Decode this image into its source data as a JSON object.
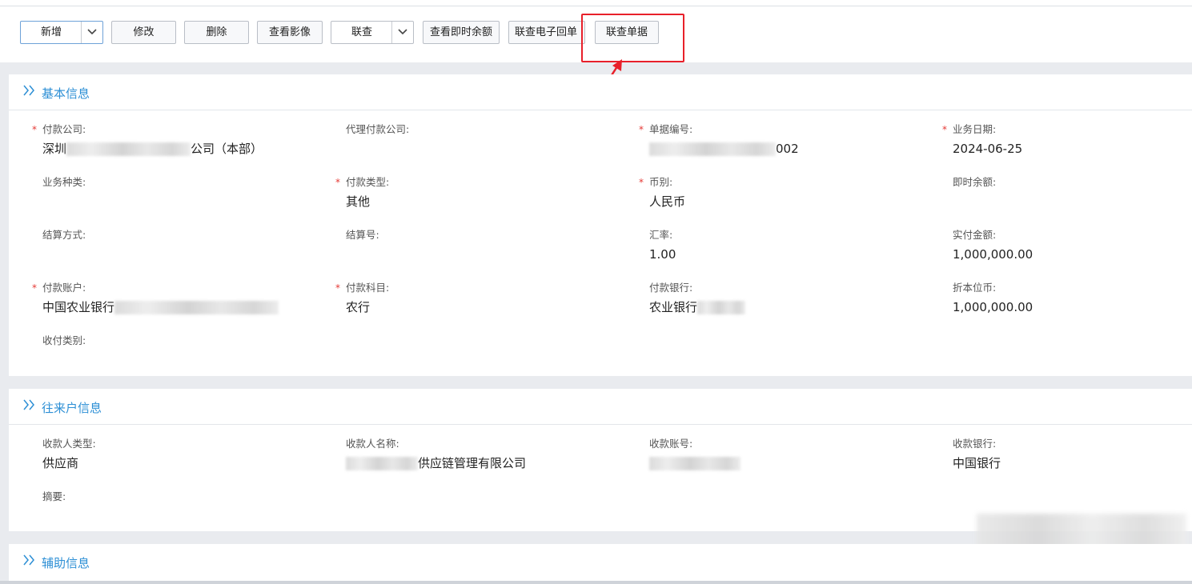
{
  "toolbar": {
    "add_label": "新增",
    "modify_label": "修改",
    "delete_label": "删除",
    "view_image_label": "查看影像",
    "linked_query_label": "联查",
    "realtime_balance_label": "查看即时余额",
    "e_receipt_label": "联查电子回单",
    "linked_doc_label": "联查单据"
  },
  "sections": {
    "basic": {
      "title": "基本信息",
      "payer_company": {
        "label": "付款公司:",
        "prefix": "深圳",
        "suffix": "公司（本部）"
      },
      "agent_payer": {
        "label": "代理付款公司:",
        "value": ""
      },
      "doc_no": {
        "label": "单据编号:",
        "suffix": "002"
      },
      "biz_date": {
        "label": "业务日期:",
        "value": "2024-06-25"
      },
      "biz_type": {
        "label": "业务种类:",
        "value": ""
      },
      "pay_type": {
        "label": "付款类型:",
        "value": "其他"
      },
      "currency": {
        "label": "币别:",
        "value": "人民币"
      },
      "rt_balance": {
        "label": "即时余额:",
        "value": ""
      },
      "settle_method": {
        "label": "结算方式:",
        "value": ""
      },
      "settle_no": {
        "label": "结算号:",
        "value": ""
      },
      "rate": {
        "label": "汇率:",
        "value": "1.00"
      },
      "actual_amount": {
        "label": "实付金额:",
        "value": "1,000,000.00"
      },
      "pay_account": {
        "label": "付款账户:",
        "prefix": "中国农业银行"
      },
      "pay_subject": {
        "label": "付款科目:",
        "value": "农行"
      },
      "pay_bank": {
        "label": "付款银行:",
        "prefix": "农业银行"
      },
      "local_currency": {
        "label": "折本位币:",
        "value": "1,000,000.00"
      },
      "recv_pay_type": {
        "label": "收付类别:",
        "value": ""
      }
    },
    "counterparty": {
      "title": "往来户信息",
      "payee_type": {
        "label": "收款人类型:",
        "value": "供应商"
      },
      "payee_name": {
        "label": "收款人名称:",
        "suffix": "供应链管理有限公司"
      },
      "payee_account": {
        "label": "收款账号:"
      },
      "payee_bank": {
        "label": "收款银行:",
        "value": "中国银行"
      },
      "summary": {
        "label": "摘要:",
        "value": ""
      }
    },
    "aux": {
      "title": "辅助信息"
    }
  },
  "colors": {
    "accent": "#2d8fd5",
    "highlight": "#e8202a",
    "required": "#e53935"
  }
}
